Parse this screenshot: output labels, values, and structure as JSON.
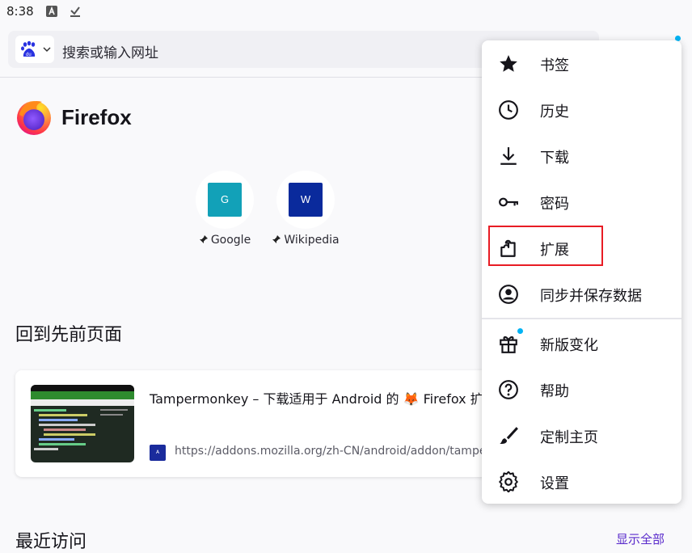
{
  "status": {
    "time": "8:38"
  },
  "urlbar": {
    "placeholder": "搜索或输入网址"
  },
  "brand": {
    "name": "Firefox"
  },
  "top_sites": [
    {
      "tile": "G",
      "label": "Google",
      "color": "#12a1b8"
    },
    {
      "tile": "W",
      "label": "Wikipedia",
      "color": "#0a2a9c"
    }
  ],
  "jump_back": {
    "heading": "回到先前页面",
    "card": {
      "title": "Tampermonkey – 下载适用于 Android 的 🦊 Firefox 扩展",
      "favicon_text": "A",
      "url": "https://addons.mozilla.org/zh-CN/android/addon/tampermonkey/"
    }
  },
  "recent": {
    "heading": "最近访问",
    "show_all": "显示全部"
  },
  "menu": {
    "items": [
      {
        "label": "书签",
        "icon": "star-icon"
      },
      {
        "label": "历史",
        "icon": "clock-icon"
      },
      {
        "label": "下载",
        "icon": "download-icon"
      },
      {
        "label": "密码",
        "icon": "key-icon"
      },
      {
        "label": "扩展",
        "icon": "puzzle-icon"
      },
      {
        "label": "同步并保存数据",
        "icon": "account-icon"
      },
      {
        "label": "新版变化",
        "icon": "gift-icon"
      },
      {
        "label": "帮助",
        "icon": "help-icon"
      },
      {
        "label": "定制主页",
        "icon": "brush-icon"
      },
      {
        "label": "设置",
        "icon": "gear-icon"
      }
    ]
  },
  "colors": {
    "accent": "#592acb",
    "notification_dot": "#00b3f4",
    "highlight_box": "#e81c24"
  }
}
